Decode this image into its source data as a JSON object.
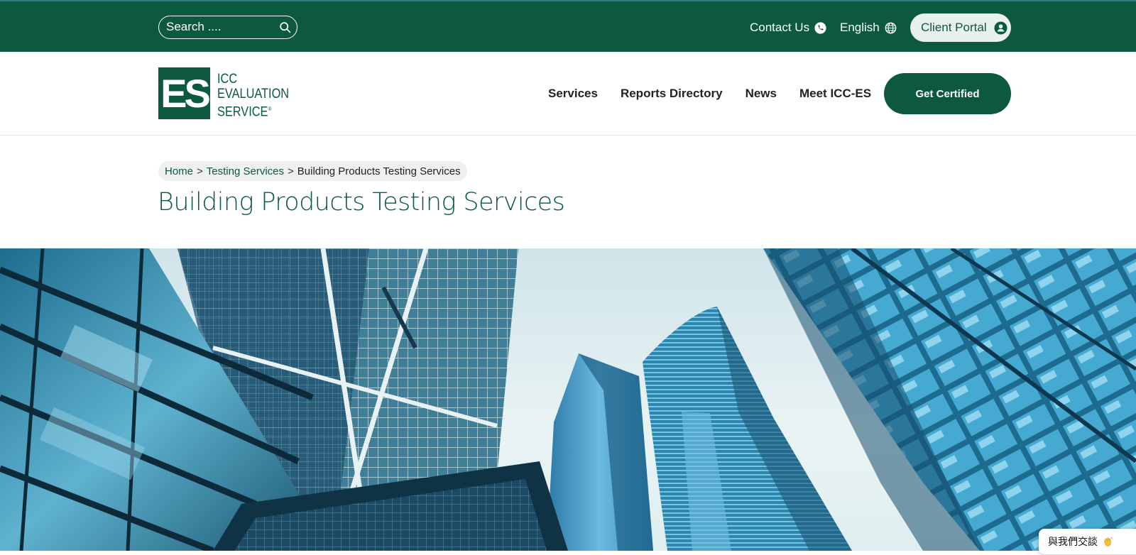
{
  "topbar": {
    "search_placeholder": "Search ....",
    "search_icon": "search-icon",
    "contact_label": "Contact Us",
    "contact_icon": "phone-icon",
    "language_label": "English",
    "language_icon": "globe-icon",
    "portal_label": "Client Portal",
    "portal_icon": "user-circle-icon"
  },
  "header": {
    "logo_mark": "ES",
    "logo_line1": "ICC",
    "logo_line2": "EVALUATION",
    "logo_line3": "SERVICE",
    "logo_reg": "®",
    "nav": [
      "Services",
      "Reports Directory",
      "News",
      "Meet ICC-ES"
    ],
    "cta_label": "Get Certified"
  },
  "breadcrumb": {
    "items": [
      "Home",
      "Testing Services",
      "Building Products Testing Services"
    ],
    "separator": ">"
  },
  "page": {
    "title": "Building Products Testing Services"
  },
  "chat_widget": {
    "label": "與我們交談",
    "icon": "waving-hand-icon"
  },
  "colors": {
    "brand_green": "#0c5940",
    "portal_bg": "#e9f1ee",
    "breadcrumb_bg": "#eef0f2"
  }
}
